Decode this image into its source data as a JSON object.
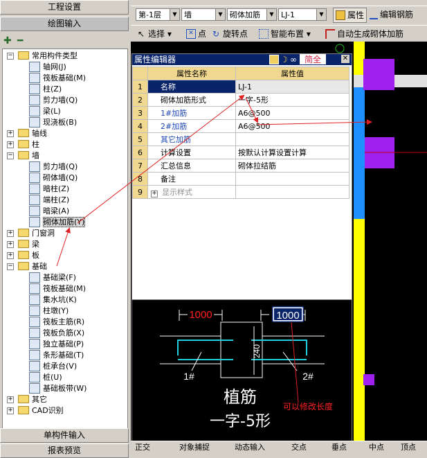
{
  "left_panel": {
    "header_top": "工程设置",
    "header_draw": "绘图输入",
    "footer_single": "单构件输入",
    "footer_report": "报表预览"
  },
  "tree": [
    {
      "label": "常用构件类型",
      "level": 0,
      "kind": "folder",
      "exp": "−"
    },
    {
      "label": "轴网(J)",
      "level": 1,
      "kind": "comp"
    },
    {
      "label": "筏板基础(M)",
      "level": 1,
      "kind": "comp"
    },
    {
      "label": "柱(Z)",
      "level": 1,
      "kind": "comp"
    },
    {
      "label": "剪力墙(Q)",
      "level": 1,
      "kind": "comp"
    },
    {
      "label": "梁(L)",
      "level": 1,
      "kind": "comp"
    },
    {
      "label": "现浇板(B)",
      "level": 1,
      "kind": "comp"
    },
    {
      "label": "轴线",
      "level": 0,
      "kind": "folder",
      "exp": "+"
    },
    {
      "label": "柱",
      "level": 0,
      "kind": "folder",
      "exp": "+"
    },
    {
      "label": "墙",
      "level": 0,
      "kind": "folder",
      "exp": "−"
    },
    {
      "label": "剪力墙(Q)",
      "level": 1,
      "kind": "comp"
    },
    {
      "label": "砌体墙(Q)",
      "level": 1,
      "kind": "comp"
    },
    {
      "label": "暗柱(Z)",
      "level": 1,
      "kind": "comp"
    },
    {
      "label": "端柱(Z)",
      "level": 1,
      "kind": "comp"
    },
    {
      "label": "暗梁(A)",
      "level": 1,
      "kind": "comp"
    },
    {
      "label": "砌体加筋(Y)",
      "level": 1,
      "kind": "comp",
      "selected": true
    },
    {
      "label": "门窗洞",
      "level": 0,
      "kind": "folder",
      "exp": "+"
    },
    {
      "label": "梁",
      "level": 0,
      "kind": "folder",
      "exp": "+"
    },
    {
      "label": "板",
      "level": 0,
      "kind": "folder",
      "exp": "+"
    },
    {
      "label": "基础",
      "level": 0,
      "kind": "folder",
      "exp": "−"
    },
    {
      "label": "基础梁(F)",
      "level": 1,
      "kind": "comp"
    },
    {
      "label": "筏板基础(M)",
      "level": 1,
      "kind": "comp"
    },
    {
      "label": "集水坑(K)",
      "level": 1,
      "kind": "comp"
    },
    {
      "label": "柱墩(Y)",
      "level": 1,
      "kind": "comp"
    },
    {
      "label": "筏板主筋(R)",
      "level": 1,
      "kind": "comp"
    },
    {
      "label": "筏板负筋(X)",
      "level": 1,
      "kind": "comp"
    },
    {
      "label": "独立基础(P)",
      "level": 1,
      "kind": "comp"
    },
    {
      "label": "条形基础(T)",
      "level": 1,
      "kind": "comp"
    },
    {
      "label": "桩承台(V)",
      "level": 1,
      "kind": "comp"
    },
    {
      "label": "桩(U)",
      "level": 1,
      "kind": "comp"
    },
    {
      "label": "基础板带(W)",
      "level": 1,
      "kind": "comp"
    },
    {
      "label": "其它",
      "level": 0,
      "kind": "folder",
      "exp": "+"
    },
    {
      "label": "CAD识别",
      "level": 0,
      "kind": "folder",
      "exp": "+"
    }
  ],
  "toolbar1": {
    "floor": "第-1层",
    "type": "墙",
    "subtype": "砌体加筋",
    "name": "LJ-1",
    "property_btn": "属性",
    "edit_rebar_btn": "编辑钢筋"
  },
  "toolbar2": {
    "select": "选择",
    "point": "点",
    "rotate_point": "旋转点",
    "smart_layout": "智能布置",
    "auto_generate": "自动生成砌体加筋"
  },
  "prop_editor": {
    "title": "属性编辑器",
    "simplified": "简全",
    "col_name": "属性名称",
    "col_value": "属性值",
    "rows": [
      {
        "num": "1",
        "name": "名称",
        "value": "LJ-1",
        "style": "normal",
        "selected": true
      },
      {
        "num": "2",
        "name": "砌体加筋形式",
        "value": "一字-5形",
        "style": "normal"
      },
      {
        "num": "3",
        "name": "1#加筋",
        "value": "A6@500",
        "style": "blue"
      },
      {
        "num": "4",
        "name": "2#加筋",
        "value": "A6@500",
        "style": "blue"
      },
      {
        "num": "5",
        "name": "其它加筋",
        "value": "",
        "style": "blue"
      },
      {
        "num": "6",
        "name": "计算设置",
        "value": "按默认计算设置计算",
        "style": "normal"
      },
      {
        "num": "7",
        "name": "汇总信息",
        "value": "砌体拉结筋",
        "style": "normal"
      },
      {
        "num": "8",
        "name": "备注",
        "value": "",
        "style": "normal"
      },
      {
        "num": "9",
        "name": "显示样式",
        "value": "",
        "style": "gray",
        "expander": "+"
      }
    ]
  },
  "preview": {
    "dim_left": "1000",
    "dim_right": "1000",
    "dim_mid": "240",
    "label_1": "1#",
    "label_2": "2#",
    "title_line1": "植筋",
    "title_line2": "一字-5形",
    "annotation": "可以修改长度"
  },
  "bottom_bar": {
    "ortho": "正交",
    "snap": "对象捕捉",
    "dyn_input": "动态输入",
    "cross": "交点",
    "perp": "垂点",
    "mid": "中点",
    "vertex": "顶点"
  },
  "colors": {
    "title_bar": "#0a246a",
    "header_cell": "#f0d890",
    "yellow_wall": "#ffff00",
    "blue_wall": "#1e90ff",
    "magenta_col": "#a020f0",
    "dim_red": "#ff2020",
    "rebar_cyan": "#20d0e0",
    "arrow_red": "#e02020"
  }
}
